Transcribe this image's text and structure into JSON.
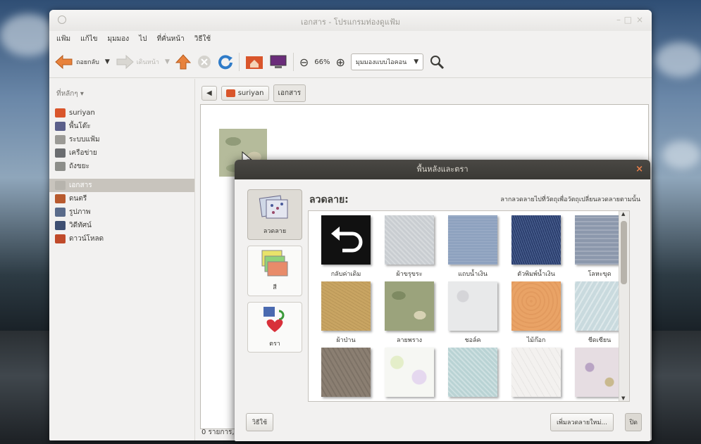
{
  "window": {
    "title": "เอกสาร - โปรแกรมท่องดูแฟ้ม",
    "menu": [
      "แฟ้ม",
      "แก้ไข",
      "มุมมอง",
      "ไป",
      "ที่คั่นหน้า",
      "วิธีใช้"
    ]
  },
  "toolbar": {
    "back_label": "ถอยกลับ",
    "forward_label": "เดินหน้า",
    "zoom_value": "66%",
    "view_mode": "มุมมองแบบไอคอน"
  },
  "sidebar": {
    "header": "ที่หลักๆ ▾",
    "items": [
      {
        "label": "suriyan",
        "color": "#d9552b"
      },
      {
        "label": "พื้นโต๊ะ",
        "color": "#5b5f8a"
      },
      {
        "label": "ระบบแฟ้ม",
        "color": "#9b9a96"
      },
      {
        "label": "เครือข่าย",
        "color": "#6b6d70"
      },
      {
        "label": "ถังขยะ",
        "color": "#8d8e8a"
      },
      {
        "label": "เอกสาร",
        "color": "#b7b4ad"
      },
      {
        "label": "ดนตรี",
        "color": "#b85a2e"
      },
      {
        "label": "รูปภาพ",
        "color": "#5a6b8a"
      },
      {
        "label": "วิดีทัศน์",
        "color": "#3e4f72"
      },
      {
        "label": "ดาวน์โหลด",
        "color": "#c04a2a"
      }
    ],
    "selected_index": 5
  },
  "pathbar": {
    "home_label": "suriyan",
    "current_label": "เอกสาร"
  },
  "status": {
    "text": "0 รายการ,"
  },
  "dialog": {
    "title": "พื้นหลังและตรา",
    "close_glyph": "×",
    "categories": [
      {
        "label": "ลวดลาย"
      },
      {
        "label": "สี"
      },
      {
        "label": "ตรา"
      }
    ],
    "pattern_heading": "ลวดลาย:",
    "pattern_hint": "ลากลวดลายไปที่วัตถุเพื่อวัตถุเปลี่ยนลวดลายตามนั้น",
    "patterns": [
      {
        "label": "กลับค่าเดิม",
        "color": "#111111"
      },
      {
        "label": "ผ้าขรุขระ",
        "color": "#c9cdd1"
      },
      {
        "label": "แถบน้ำเงิน",
        "color": "#8ea2bf"
      },
      {
        "label": "ตัวพิมพ์น้ำเงิน",
        "color": "#2c3f6e"
      },
      {
        "label": "โลหะขุด",
        "color": "#8c98ac"
      },
      {
        "label": "ผ้าป่าน",
        "color": "#c8a462"
      },
      {
        "label": "ลายพราง",
        "color": "#9ba37c"
      },
      {
        "label": "ชอล์ค",
        "color": "#e8e9ea"
      },
      {
        "label": "ไม้ก๊อก",
        "color": "#e9a366"
      },
      {
        "label": "ชีดเซียน",
        "color": "#c9dade"
      },
      {
        "label": "",
        "color": "#8b7f72"
      },
      {
        "label": "",
        "color": "#f6f7f3"
      },
      {
        "label": "",
        "color": "#b9d3d4"
      },
      {
        "label": "",
        "color": "#f3f1ef"
      },
      {
        "label": "",
        "color": "#e6dde2"
      }
    ],
    "help_label": "วิธีใช้",
    "add_pattern_label": "เพิ่มลวดลายใหม่...",
    "close_label": "ปิด"
  }
}
